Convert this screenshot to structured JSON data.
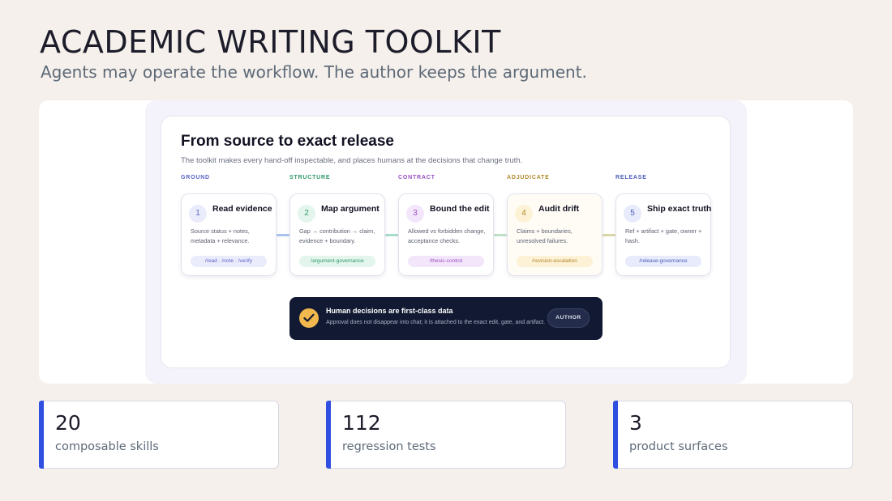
{
  "header": {
    "title": "ACADEMIC WRITING TOOLKIT",
    "subtitle": "Agents may operate the workflow. The author keeps the argument."
  },
  "panel": {
    "title": "From source to exact release",
    "subtitle": "The toolkit makes every hand-off inspectable, and places humans at the decisions that change truth."
  },
  "stages": [
    {
      "label": "GROUND",
      "number": "1",
      "title": "Read evidence",
      "desc": "Source status + notes, metadata + relevance.",
      "tag": "/read · /note · /verify",
      "color": "#5b63c9",
      "tint": "#ebecfb"
    },
    {
      "label": "STRUCTURE",
      "number": "2",
      "title": "Map argument",
      "desc": "Gap → contribution → claim, evidence + boundary.",
      "tag": "/argument-governance",
      "color": "#2f9a6a",
      "tint": "#e3f5ec"
    },
    {
      "label": "CONTRACT",
      "number": "3",
      "title": "Bound the edit",
      "desc": "Allowed vs forbidden change, acceptance checks.",
      "tag": "/thesis-control",
      "color": "#9a4fc2",
      "tint": "#f3e6fb"
    },
    {
      "label": "ADJUDICATE",
      "number": "4",
      "title": "Audit drift",
      "desc": "Claims + boundaries, unresolved failures.",
      "tag": "/revision-escalation",
      "color": "#b0892a",
      "tint": "#fdf1d6"
    },
    {
      "label": "RELEASE",
      "number": "5",
      "title": "Ship exact truth",
      "desc": "Ref + artifact + gate, owner + hash.",
      "tag": "/release-governance",
      "color": "#4a5bb8",
      "tint": "#e7ebfb"
    }
  ],
  "decision": {
    "title": "Human decisions are first-class data",
    "subtitle": "Approval does not disappear into chat; it is attached to the exact edit, gate, and artifact.",
    "button": "AUTHOR"
  },
  "stats": [
    {
      "value": "20",
      "label": "composable skills"
    },
    {
      "value": "112",
      "label": "regression tests"
    },
    {
      "value": "3",
      "label": "product surfaces"
    }
  ]
}
